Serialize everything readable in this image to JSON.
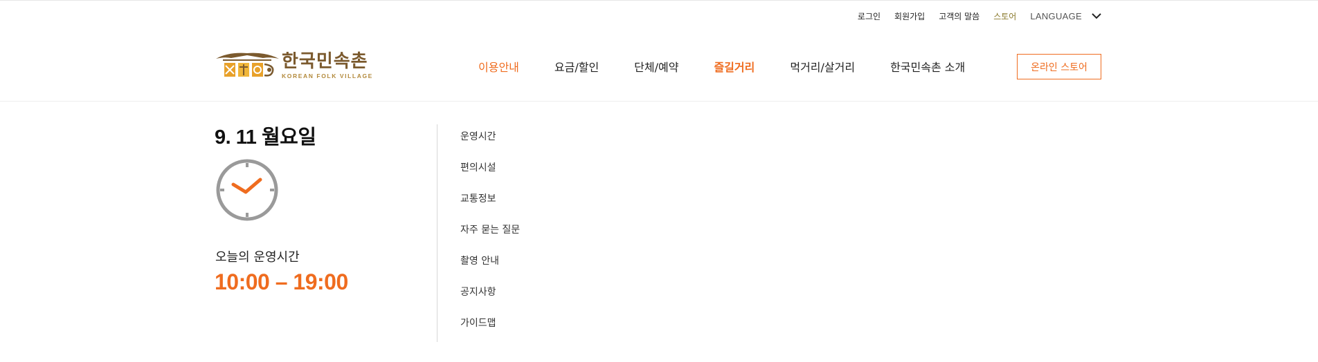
{
  "utility_nav": {
    "login": "로그인",
    "signup": "회원가입",
    "customer_voice": "고객의 말씀",
    "store": "스토어",
    "language": "LANGUAGE"
  },
  "logo": {
    "name_ko": "한국민속촌",
    "name_en": "KOREAN FOLK VILLAGE"
  },
  "main_nav": [
    {
      "label": "이용안내",
      "state": "active"
    },
    {
      "label": "요금/할인"
    },
    {
      "label": "단체/예약"
    },
    {
      "label": "즐길거리",
      "state": "highlighted"
    },
    {
      "label": "먹거리/살거리"
    },
    {
      "label": "한국민속촌 소개"
    }
  ],
  "online_store_button": "온라인 스토어",
  "today": {
    "date": "9. 11 월요일",
    "label": "오늘의 운영시간",
    "hours": "10:00 – 19:00"
  },
  "submenu": [
    "운영시간",
    "편의시설",
    "교통정보",
    "자주 묻는 질문",
    "촬영 안내",
    "공지사항",
    "가이드맵"
  ],
  "colors": {
    "accent": "#ef6c1f",
    "store": "#8a7a2c",
    "logo_brown": "#7b5a2e",
    "clock_gray": "#9a9a9a"
  }
}
